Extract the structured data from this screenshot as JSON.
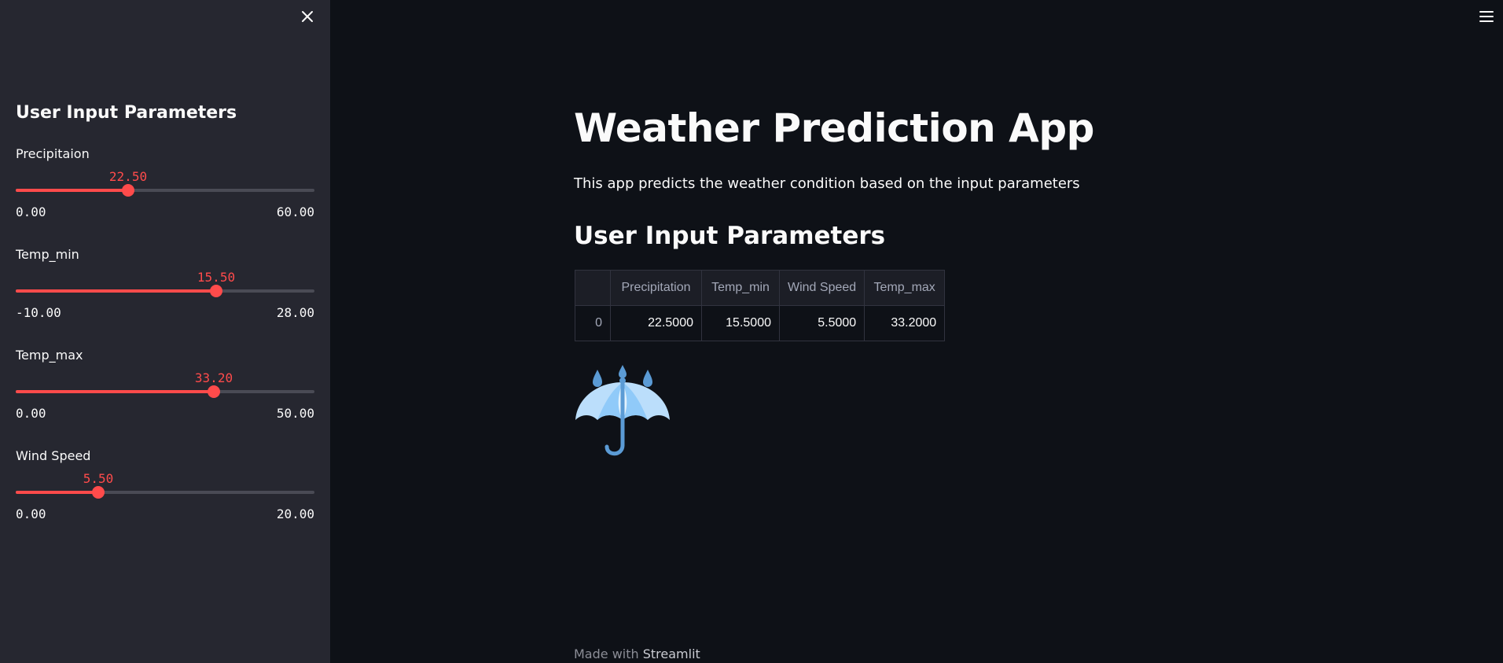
{
  "sidebar": {
    "title": "User Input Parameters",
    "close_icon": "close-icon",
    "sliders": [
      {
        "label": "Precipitaion",
        "value": "22.50",
        "min": "0.00",
        "max": "60.00",
        "fraction": 0.375
      },
      {
        "label": "Temp_min",
        "value": "15.50",
        "min": "-10.00",
        "max": "28.00",
        "fraction": 0.671
      },
      {
        "label": "Temp_max",
        "value": "33.20",
        "min": "0.00",
        "max": "50.00",
        "fraction": 0.664
      },
      {
        "label": "Wind Speed",
        "value": "5.50",
        "min": "0.00",
        "max": "20.00",
        "fraction": 0.275
      }
    ]
  },
  "main": {
    "menu_icon": "hamburger-menu-icon",
    "title": "Weather Prediction App",
    "description": "This app predicts the weather condition based on the input parameters",
    "section_title": "User Input Parameters",
    "table": {
      "columns": [
        "",
        "Precipitation",
        "Temp_min",
        "Wind Speed",
        "Temp_max"
      ],
      "rows": [
        [
          "0",
          "22.5000",
          "15.5000",
          "5.5000",
          "33.2000"
        ]
      ]
    },
    "prediction_icon": "umbrella-with-rain-drops-icon"
  },
  "footer": {
    "prefix": "Made with ",
    "brand": "Streamlit"
  },
  "colors": {
    "accent": "#ff4b4b",
    "background": "#0e1117",
    "sidebar": "#262730"
  }
}
